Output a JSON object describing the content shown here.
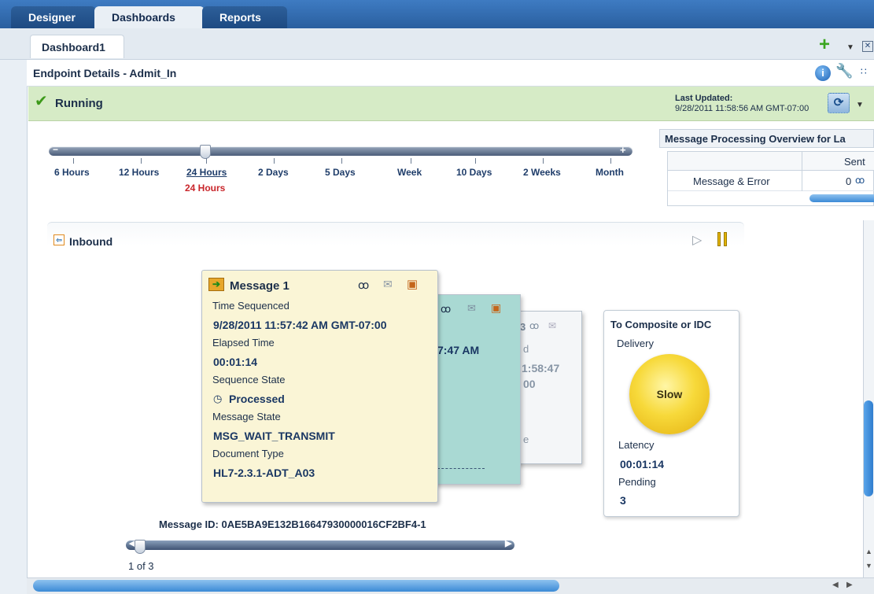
{
  "tabs": [
    {
      "label": "Designer"
    },
    {
      "label": "Dashboards"
    },
    {
      "label": "Reports"
    }
  ],
  "subtab": {
    "label": "Dashboard1"
  },
  "header": {
    "title": "Endpoint Details - Admit_In"
  },
  "status": {
    "label": "Running",
    "last_updated_label": "Last Updated:",
    "last_updated_value": "9/28/2011 11:58:56 AM GMT-07:00"
  },
  "timeline": {
    "labels": [
      "6 Hours",
      "12 Hours",
      "24 Hours",
      "2 Days",
      "5 Days",
      "Week",
      "10 Days",
      "2 Weeks",
      "Month"
    ],
    "selected": "24 Hours"
  },
  "overview": {
    "title": "Message Processing Overview for La",
    "col_sent": "Sent",
    "row_label": "Message & Error",
    "row_value": "0"
  },
  "inbound": {
    "label": "Inbound"
  },
  "card1": {
    "title": "Message 1",
    "time_seq_label": "Time Sequenced",
    "time_seq_value": "9/28/2011 11:57:42 AM GMT-07:00",
    "elapsed_label": "Elapsed Time",
    "elapsed_value": "00:01:14",
    "seq_state_label": "Sequence State",
    "seq_state_value": "Processed",
    "msg_state_label": "Message State",
    "msg_state_value": "MSG_WAIT_TRANSMIT",
    "doc_type_label": "Document Type",
    "doc_type_value": "HL7-2.3.1-ADT_A03"
  },
  "card2": {
    "fragment": "7:47 AM"
  },
  "card3": {
    "frag1": "3",
    "frag2": "d",
    "frag3": "1:58:47",
    "frag4": "00",
    "frag5": "e"
  },
  "composite": {
    "title": "To Composite or IDC",
    "delivery_label": "Delivery",
    "status": "Slow",
    "latency_label": "Latency",
    "latency_value": "00:01:14",
    "pending_label": "Pending",
    "pending_value": "3"
  },
  "message_id": "Message ID: 0AE5BA9E132B16647930000016CF2BF4-1",
  "pager": "1 of 3",
  "colors": {
    "accent": "#2f7dce",
    "running_bg": "#d6ebc6",
    "slow": "#f7d93a",
    "selected_label": "#c9262b"
  }
}
